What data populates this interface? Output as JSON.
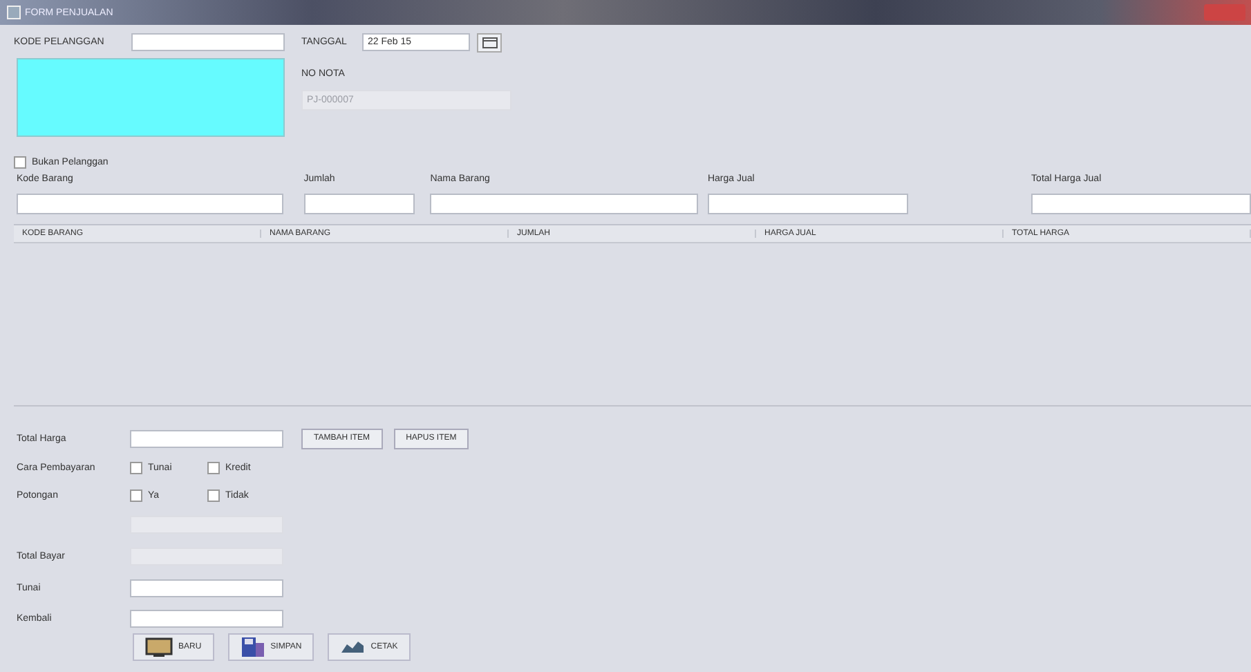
{
  "window": {
    "title": "FORM PENJUALAN"
  },
  "customer": {
    "label": "KODE PELANGGAN"
  },
  "date": {
    "label": "TANGGAL",
    "value": "22 Feb 15"
  },
  "invoice": {
    "label": "NO NOTA",
    "value": "PJ-000007"
  },
  "non_customer": {
    "label": "Bukan Pelanggan",
    "checked": false
  },
  "item_fields": [
    {
      "label": "Kode Barang"
    },
    {
      "label": "Jumlah"
    },
    {
      "label": "Nama Barang"
    },
    {
      "label": "Harga Jual"
    },
    {
      "label": "Total Harga Jual"
    }
  ],
  "table": {
    "columns": [
      "KODE BARANG",
      "NAMA BARANG",
      "JUMLAH",
      "HARGA JUAL",
      "TOTAL HARGA"
    ]
  },
  "total": {
    "label": "Total Harga"
  },
  "item_buttons": [
    "TAMBAH ITEM",
    "HAPUS ITEM"
  ],
  "payment": {
    "label": "Cara Pembayaran",
    "options": [
      {
        "label": "Tunai",
        "checked": false
      },
      {
        "label": "Kredit",
        "checked": false
      }
    ]
  },
  "discount": {
    "label": "Potongan",
    "options": [
      {
        "label": "Ya",
        "checked": false
      },
      {
        "label": "Tidak",
        "checked": false
      }
    ]
  },
  "total_paid": {
    "label": "Total Bayar"
  },
  "cash": {
    "label": "Tunai"
  },
  "change": {
    "label": "Kembali"
  },
  "actions": [
    {
      "label": "BARU",
      "kind": "new"
    },
    {
      "label": "SIMPAN",
      "kind": "save"
    },
    {
      "label": "CETAK",
      "kind": "print"
    }
  ]
}
